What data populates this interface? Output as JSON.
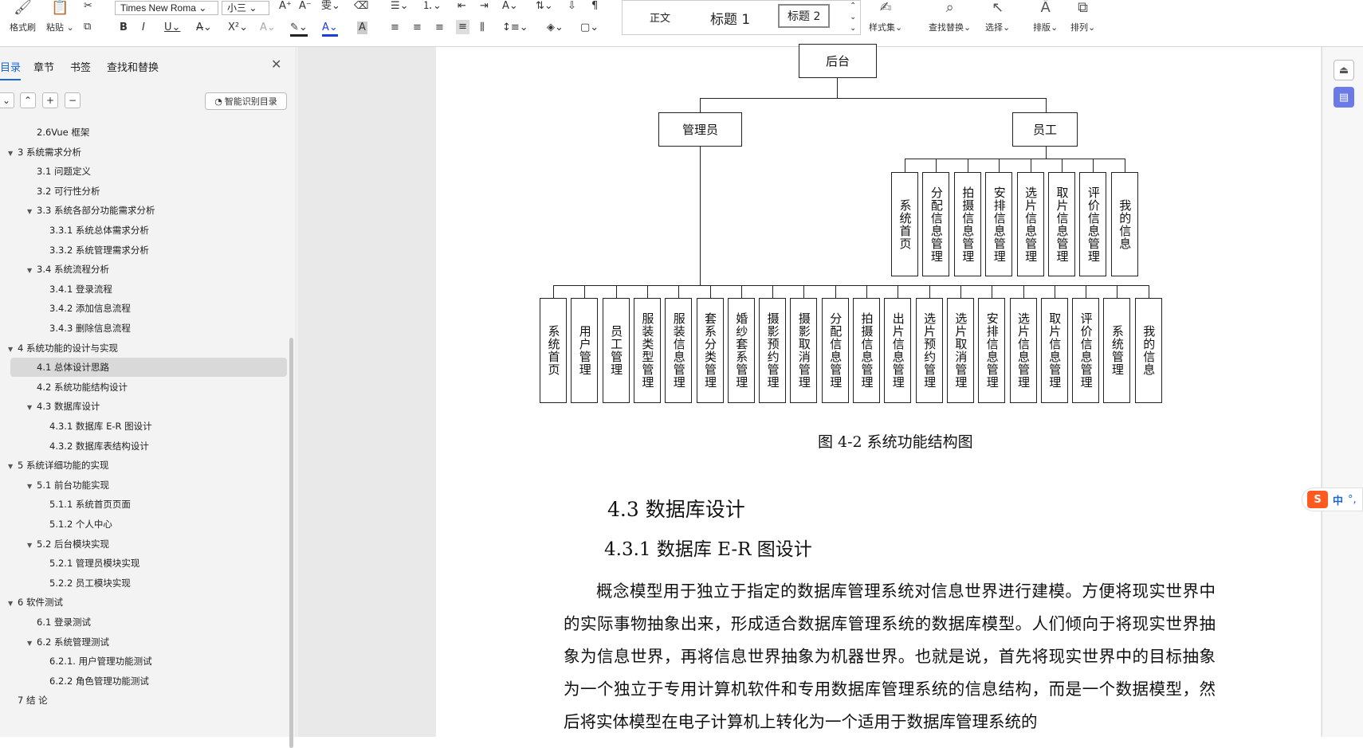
{
  "toolbar": {
    "format_painter": "格式刷",
    "paste": "粘贴",
    "font_name": "Times New Roma",
    "font_size": "小三",
    "style_normal": "正文",
    "style_heading1": "标题 1",
    "style_heading2": "标题 2",
    "style_set": "样式集",
    "find_replace": "查找替换",
    "select": "选择",
    "layout": "排版",
    "arrange": "排列"
  },
  "sidebar": {
    "tabs": [
      "目录",
      "章节",
      "书签",
      "查找和替换"
    ],
    "smart_toc": "智能识别目录",
    "items": [
      {
        "label": "2.6Vue 框架",
        "level": 2,
        "expand": ""
      },
      {
        "label": "3  系统需求分析",
        "level": 1,
        "expand": "▼"
      },
      {
        "label": "3.1  问题定义",
        "level": 2,
        "expand": ""
      },
      {
        "label": "3.2  可行性分析",
        "level": 2,
        "expand": ""
      },
      {
        "label": "3.3  系统各部分功能需求分析",
        "level": 2,
        "expand": "▼"
      },
      {
        "label": "3.3.1  系统总体需求分析",
        "level": 3,
        "expand": ""
      },
      {
        "label": "3.3.2  系统管理需求分析",
        "level": 3,
        "expand": ""
      },
      {
        "label": "3.4  系统流程分析",
        "level": 2,
        "expand": "▼"
      },
      {
        "label": "3.4.1  登录流程",
        "level": 3,
        "expand": ""
      },
      {
        "label": "3.4.2  添加信息流程",
        "level": 3,
        "expand": ""
      },
      {
        "label": "3.4.3  删除信息流程",
        "level": 3,
        "expand": ""
      },
      {
        "label": "4  系统功能的设计与实现",
        "level": 1,
        "expand": "▼"
      },
      {
        "label": "4.1  总体设计思路",
        "level": 2,
        "expand": ""
      },
      {
        "label": "4.2  系统功能结构设计",
        "level": 2,
        "expand": ""
      },
      {
        "label": "4.3  数据库设计",
        "level": 2,
        "expand": "▼"
      },
      {
        "label": "4.3.1  数据库 E-R 图设计",
        "level": 3,
        "expand": ""
      },
      {
        "label": "4.3.2  数据库表结构设计",
        "level": 3,
        "expand": ""
      },
      {
        "label": "5  系统详细功能的实现",
        "level": 1,
        "expand": "▼"
      },
      {
        "label": "5.1 前台功能实现",
        "level": 2,
        "expand": "▼"
      },
      {
        "label": "5.1.1 系统首页页面",
        "level": 3,
        "expand": ""
      },
      {
        "label": "5.1.2 个人中心",
        "level": 3,
        "expand": ""
      },
      {
        "label": "5.2 后台模块实现",
        "level": 2,
        "expand": "▼"
      },
      {
        "label": "5.2.1 管理员模块实现",
        "level": 3,
        "expand": ""
      },
      {
        "label": "5.2.2 员工模块实现",
        "level": 3,
        "expand": ""
      },
      {
        "label": "6  软件测试",
        "level": 1,
        "expand": "▼"
      },
      {
        "label": "6.1  登录测试",
        "level": 2,
        "expand": ""
      },
      {
        "label": "6.2  系统管理测试",
        "level": 2,
        "expand": "▼"
      },
      {
        "label": "6.2.1.  用户管理功能测试",
        "level": 3,
        "expand": ""
      },
      {
        "label": "6.2.2  角色管理功能测试",
        "level": 3,
        "expand": ""
      },
      {
        "label": "7  结  论",
        "level": 1,
        "expand": ""
      }
    ],
    "selected_index": 12
  },
  "diagram": {
    "root": "后台",
    "admin": "管理员",
    "staff": "员工",
    "staff_children": [
      "系统首页",
      "分配信息管理",
      "拍摄信息管理",
      "安排信息管理",
      "选片信息管理",
      "取片信息管理",
      "评价信息管理",
      "我的信息"
    ],
    "admin_children": [
      "系统首页",
      "用户管理",
      "员工管理",
      "服装类型管理",
      "服装信息管理",
      "套系分类管理",
      "婚纱套系管理",
      "摄影预约管理",
      "摄影取消管理",
      "分配信息管理",
      "拍摄信息管理",
      "出片信息管理",
      "选片预约管理",
      "选片取消管理",
      "安排信息管理",
      "选片信息管理",
      "取片信息管理",
      "评价信息管理",
      "系统管理",
      "我的信息"
    ]
  },
  "document": {
    "caption": "图 4-2  系统功能结构图",
    "heading2": "4.3  数据库设计",
    "heading3": "4.3.1  数据库 E-R 图设计",
    "paragraph": "概念模型用于独立于指定的数据库管理系统对信息世界进行建模。方便将现实世界中的实际事物抽象出来，形成适合数据库管理系统的数据库模型。人们倾向于将现实世界抽象为信息世界，再将信息世界抽象为机器世界。也就是说，首先将现实世界中的目标抽象为一个独立于专用计算机软件和专用数据库管理系统的信息结构，而是一个数据模型，然后将实体模型在电子计算机上转化为一个适用于数据库管理系统的"
  },
  "ime": {
    "label": "中",
    "punct": "°,"
  }
}
